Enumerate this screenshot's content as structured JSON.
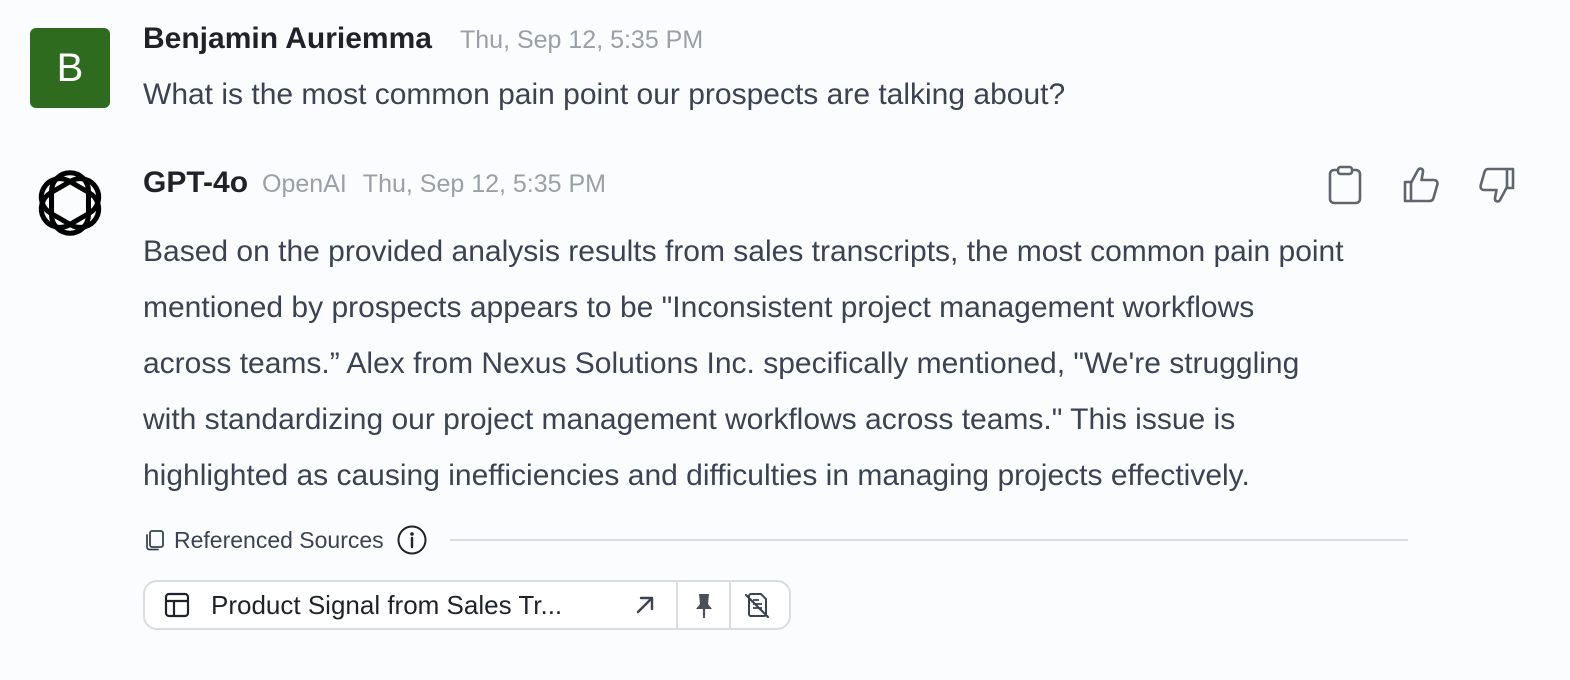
{
  "user_message": {
    "avatar_letter": "B",
    "avatar_color": "#2f6b1f",
    "name": "Benjamin Auriemma",
    "timestamp": "Thu, Sep 12, 5:35 PM",
    "text": "What is the most common pain point our prospects are talking about?"
  },
  "ai_message": {
    "avatar_icon": "openai-logo-icon",
    "name": "GPT-4o",
    "vendor": "OpenAI",
    "timestamp": "Thu, Sep 12, 5:35 PM",
    "actions": {
      "copy_icon": "clipboard-icon",
      "like_icon": "thumbs-up-icon",
      "dislike_icon": "thumbs-down-icon"
    },
    "lines": [
      "Based on the provided analysis results from sales transcripts, the most common pain point",
      "mentioned by prospects appears to be \"Inconsistent project management workflows",
      "across teams.” Alex from Nexus Solutions Inc. specifically mentioned, \"We're struggling",
      "with standardizing our project management workflows across teams.\" This issue is",
      "highlighted as causing inefficiencies and difficulties in managing projects effectively."
    ],
    "references": {
      "label": "Referenced Sources",
      "doc_icon": "documents-icon",
      "info_icon": "info-icon"
    },
    "source": {
      "type_icon": "table-icon",
      "title": "Product Signal from Sales Tr...",
      "open_icon": "arrow-up-right-icon",
      "pin_icon": "pin-icon",
      "remove_icon": "remove-document-icon"
    }
  }
}
